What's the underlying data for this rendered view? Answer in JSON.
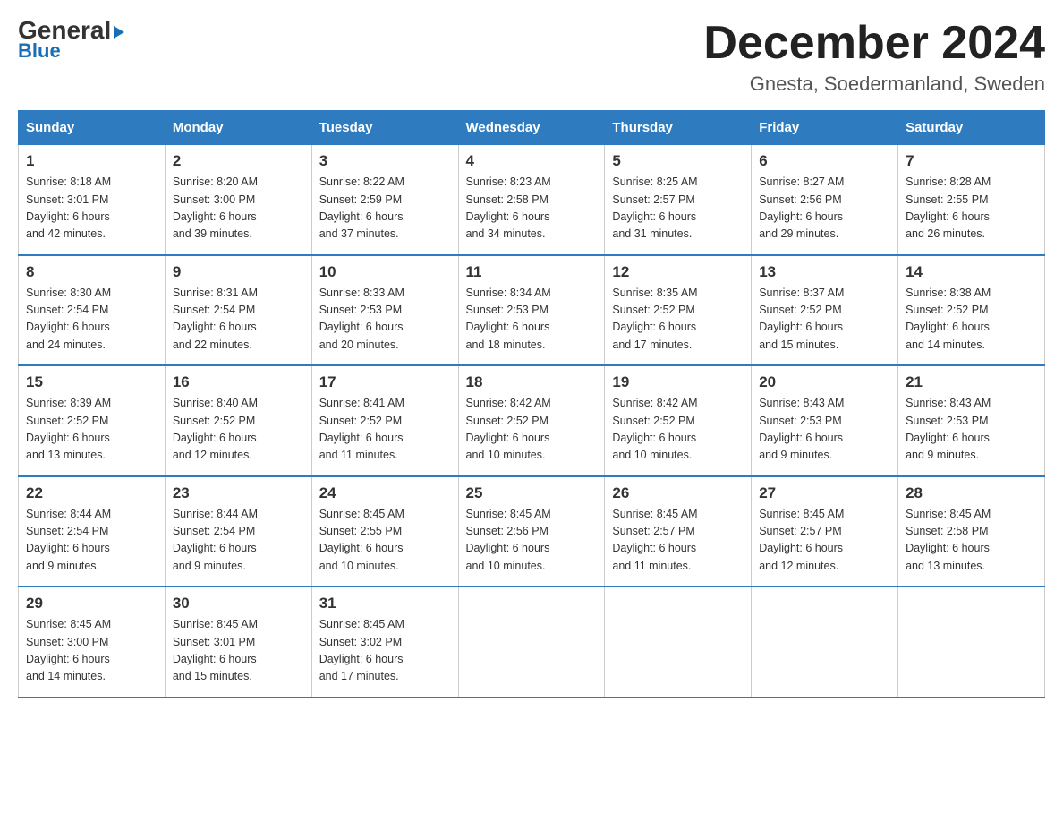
{
  "logo": {
    "general": "General",
    "blue": "Blue",
    "arrow": "▶"
  },
  "header": {
    "month": "December 2024",
    "location": "Gnesta, Soedermanland, Sweden"
  },
  "columns": [
    "Sunday",
    "Monday",
    "Tuesday",
    "Wednesday",
    "Thursday",
    "Friday",
    "Saturday"
  ],
  "weeks": [
    [
      {
        "day": "1",
        "sunrise": "8:18 AM",
        "sunset": "3:01 PM",
        "daylight": "6 hours and 42 minutes."
      },
      {
        "day": "2",
        "sunrise": "8:20 AM",
        "sunset": "3:00 PM",
        "daylight": "6 hours and 39 minutes."
      },
      {
        "day": "3",
        "sunrise": "8:22 AM",
        "sunset": "2:59 PM",
        "daylight": "6 hours and 37 minutes."
      },
      {
        "day": "4",
        "sunrise": "8:23 AM",
        "sunset": "2:58 PM",
        "daylight": "6 hours and 34 minutes."
      },
      {
        "day": "5",
        "sunrise": "8:25 AM",
        "sunset": "2:57 PM",
        "daylight": "6 hours and 31 minutes."
      },
      {
        "day": "6",
        "sunrise": "8:27 AM",
        "sunset": "2:56 PM",
        "daylight": "6 hours and 29 minutes."
      },
      {
        "day": "7",
        "sunrise": "8:28 AM",
        "sunset": "2:55 PM",
        "daylight": "6 hours and 26 minutes."
      }
    ],
    [
      {
        "day": "8",
        "sunrise": "8:30 AM",
        "sunset": "2:54 PM",
        "daylight": "6 hours and 24 minutes."
      },
      {
        "day": "9",
        "sunrise": "8:31 AM",
        "sunset": "2:54 PM",
        "daylight": "6 hours and 22 minutes."
      },
      {
        "day": "10",
        "sunrise": "8:33 AM",
        "sunset": "2:53 PM",
        "daylight": "6 hours and 20 minutes."
      },
      {
        "day": "11",
        "sunrise": "8:34 AM",
        "sunset": "2:53 PM",
        "daylight": "6 hours and 18 minutes."
      },
      {
        "day": "12",
        "sunrise": "8:35 AM",
        "sunset": "2:52 PM",
        "daylight": "6 hours and 17 minutes."
      },
      {
        "day": "13",
        "sunrise": "8:37 AM",
        "sunset": "2:52 PM",
        "daylight": "6 hours and 15 minutes."
      },
      {
        "day": "14",
        "sunrise": "8:38 AM",
        "sunset": "2:52 PM",
        "daylight": "6 hours and 14 minutes."
      }
    ],
    [
      {
        "day": "15",
        "sunrise": "8:39 AM",
        "sunset": "2:52 PM",
        "daylight": "6 hours and 13 minutes."
      },
      {
        "day": "16",
        "sunrise": "8:40 AM",
        "sunset": "2:52 PM",
        "daylight": "6 hours and 12 minutes."
      },
      {
        "day": "17",
        "sunrise": "8:41 AM",
        "sunset": "2:52 PM",
        "daylight": "6 hours and 11 minutes."
      },
      {
        "day": "18",
        "sunrise": "8:42 AM",
        "sunset": "2:52 PM",
        "daylight": "6 hours and 10 minutes."
      },
      {
        "day": "19",
        "sunrise": "8:42 AM",
        "sunset": "2:52 PM",
        "daylight": "6 hours and 10 minutes."
      },
      {
        "day": "20",
        "sunrise": "8:43 AM",
        "sunset": "2:53 PM",
        "daylight": "6 hours and 9 minutes."
      },
      {
        "day": "21",
        "sunrise": "8:43 AM",
        "sunset": "2:53 PM",
        "daylight": "6 hours and 9 minutes."
      }
    ],
    [
      {
        "day": "22",
        "sunrise": "8:44 AM",
        "sunset": "2:54 PM",
        "daylight": "6 hours and 9 minutes."
      },
      {
        "day": "23",
        "sunrise": "8:44 AM",
        "sunset": "2:54 PM",
        "daylight": "6 hours and 9 minutes."
      },
      {
        "day": "24",
        "sunrise": "8:45 AM",
        "sunset": "2:55 PM",
        "daylight": "6 hours and 10 minutes."
      },
      {
        "day": "25",
        "sunrise": "8:45 AM",
        "sunset": "2:56 PM",
        "daylight": "6 hours and 10 minutes."
      },
      {
        "day": "26",
        "sunrise": "8:45 AM",
        "sunset": "2:57 PM",
        "daylight": "6 hours and 11 minutes."
      },
      {
        "day": "27",
        "sunrise": "8:45 AM",
        "sunset": "2:57 PM",
        "daylight": "6 hours and 12 minutes."
      },
      {
        "day": "28",
        "sunrise": "8:45 AM",
        "sunset": "2:58 PM",
        "daylight": "6 hours and 13 minutes."
      }
    ],
    [
      {
        "day": "29",
        "sunrise": "8:45 AM",
        "sunset": "3:00 PM",
        "daylight": "6 hours and 14 minutes."
      },
      {
        "day": "30",
        "sunrise": "8:45 AM",
        "sunset": "3:01 PM",
        "daylight": "6 hours and 15 minutes."
      },
      {
        "day": "31",
        "sunrise": "8:45 AM",
        "sunset": "3:02 PM",
        "daylight": "6 hours and 17 minutes."
      },
      null,
      null,
      null,
      null
    ]
  ]
}
